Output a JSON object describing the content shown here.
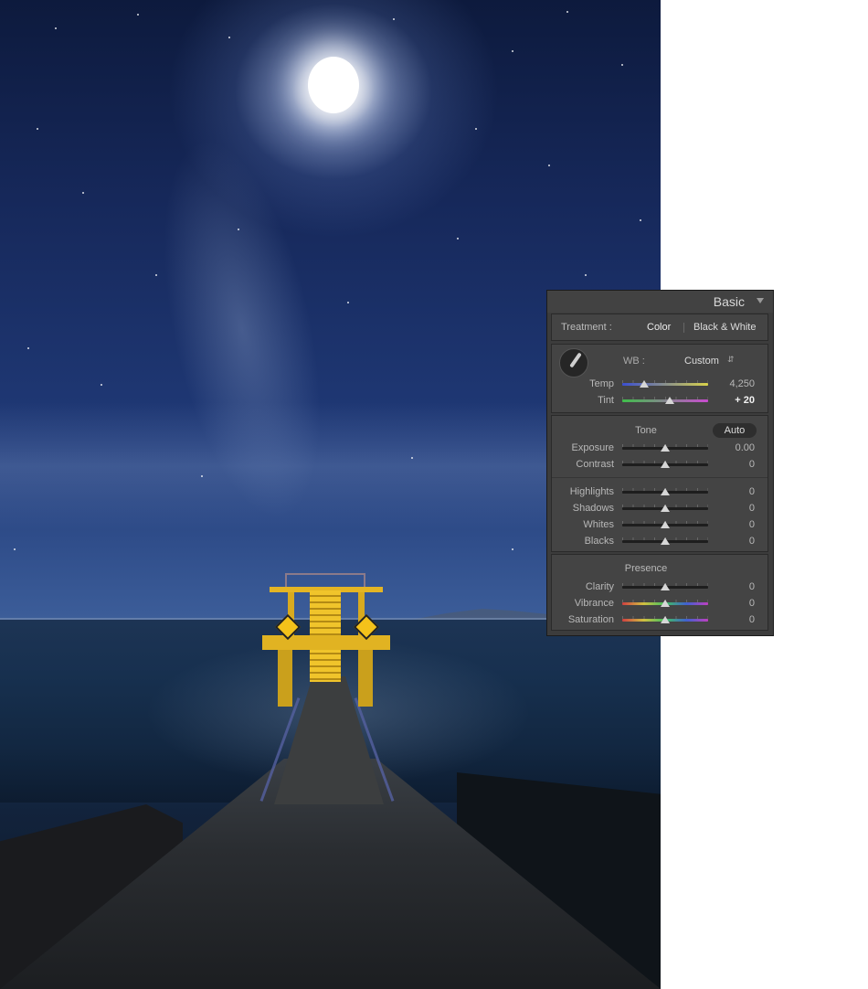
{
  "panel": {
    "title": "Basic",
    "treatment": {
      "label": "Treatment :",
      "options": [
        "Color",
        "Black & White"
      ],
      "selected": "Color"
    },
    "wb": {
      "label": "WB :",
      "value": "Custom"
    },
    "wb_sliders": [
      {
        "label": "Temp",
        "value": "4,250",
        "position": 0.25,
        "track": "temp"
      },
      {
        "label": "Tint",
        "value": "+ 20",
        "position": 0.55,
        "track": "tint",
        "highlight": true
      }
    ],
    "tone": {
      "title": "Tone",
      "auto_label": "Auto",
      "sliders": [
        {
          "label": "Exposure",
          "value": "0.00",
          "position": 0.5
        },
        {
          "label": "Contrast",
          "value": "0",
          "position": 0.5
        }
      ],
      "sliders2": [
        {
          "label": "Highlights",
          "value": "0",
          "position": 0.5
        },
        {
          "label": "Shadows",
          "value": "0",
          "position": 0.5
        },
        {
          "label": "Whites",
          "value": "0",
          "position": 0.5
        },
        {
          "label": "Blacks",
          "value": "0",
          "position": 0.5
        }
      ]
    },
    "presence": {
      "title": "Presence",
      "sliders": [
        {
          "label": "Clarity",
          "value": "0",
          "position": 0.5,
          "track": "neutral"
        },
        {
          "label": "Vibrance",
          "value": "0",
          "position": 0.5,
          "track": "color"
        },
        {
          "label": "Saturation",
          "value": "0",
          "position": 0.5,
          "track": "color"
        }
      ]
    }
  },
  "colors": {
    "temp_track": [
      "#3b4fd1",
      "#d8d24a"
    ],
    "tint_track": [
      "#3fbf4a",
      "#c94bd0"
    ],
    "color_track": [
      "#d04040",
      "#d0c040",
      "#40c060",
      "#4060d0",
      "#c040c0"
    ],
    "tower_yellow": "#e1b322"
  }
}
